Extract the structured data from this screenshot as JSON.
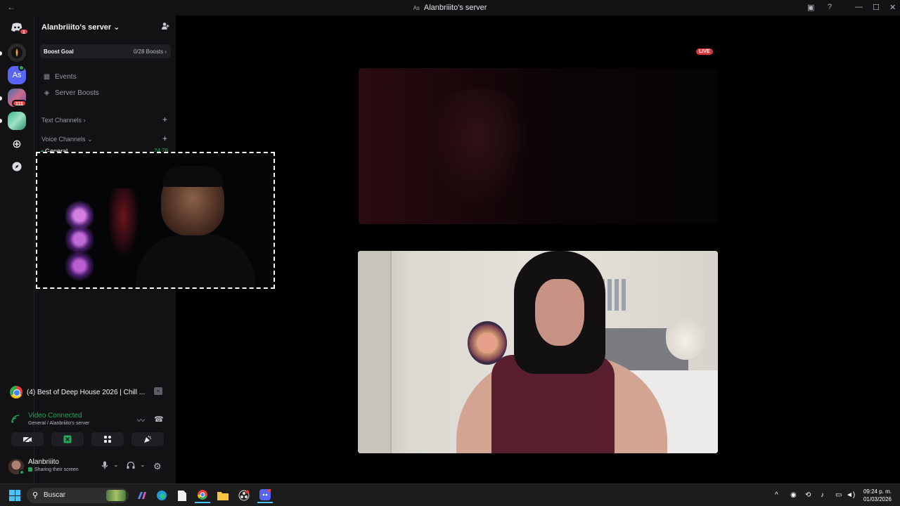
{
  "window": {
    "title": "Alanbriiito's server",
    "server_tag": "As",
    "back_icon": "arrow-left-icon"
  },
  "rail": {
    "home_badge": "1",
    "servers": [
      {
        "label": "",
        "icon": "server-fire-icon"
      },
      {
        "label": "As",
        "color": "#5865f2"
      },
      {
        "label": "",
        "icon": "server-anime-icon",
        "badge": "111"
      },
      {
        "label": "",
        "icon": "server-green-icon"
      }
    ]
  },
  "sidebar": {
    "server_name": "Alanbriiito's server",
    "boost_goal_label": "Boost Goal",
    "boost_count": "0/28 Boosts",
    "items": [
      {
        "label": "Events",
        "icon": "calendar-icon"
      },
      {
        "label": "Server Boosts",
        "icon": "boost-gem-icon"
      }
    ],
    "text_channels_label": "Text Channels",
    "voice_channels_label": "Voice Channels",
    "general_label": "General",
    "general_count": "24:28"
  },
  "stream": {
    "live_badge": "LIVE"
  },
  "panel": {
    "now_playing": "(4) Best of Deep House 2026 | Chill ...",
    "video_connected": "Video Connected",
    "voice_location": "General / Alanbriiito's server",
    "user_name": "Alanbriiito",
    "user_status": "Sharing their screen"
  },
  "taskbar": {
    "search_placeholder": "Buscar",
    "time": "09:24 p. m.",
    "date": "01/03/2026"
  },
  "colors": {
    "accent": "#5865f2",
    "connected_green": "#23a55a",
    "live_red": "#da373c",
    "badge_red": "#ed4245"
  }
}
